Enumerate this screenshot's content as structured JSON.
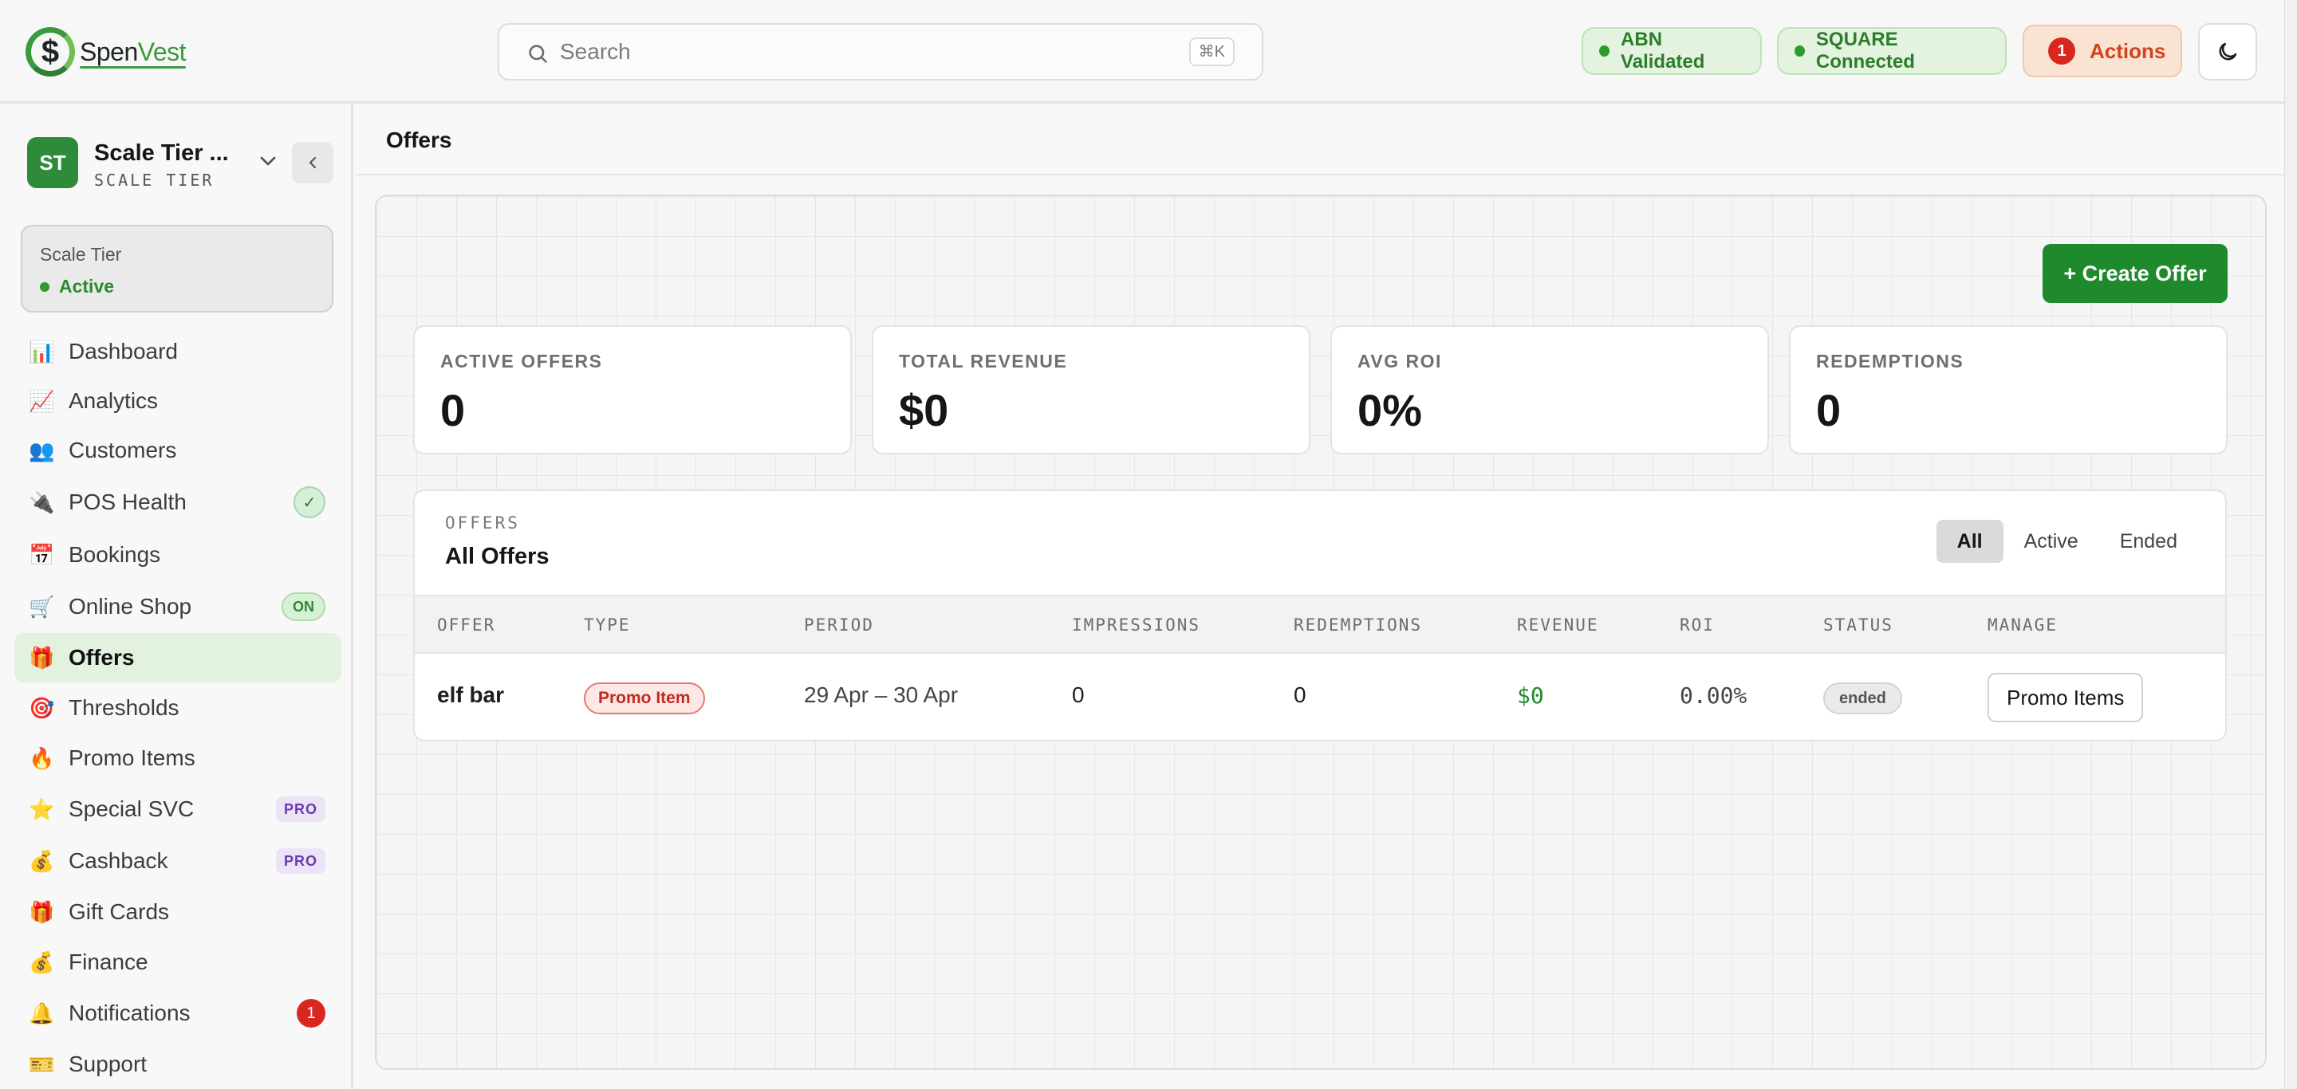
{
  "brand": {
    "name_part1": "Spen",
    "name_part2": "Vest",
    "logo_symbol": "$"
  },
  "search": {
    "placeholder": "Search",
    "shortcut": "⌘K"
  },
  "header_status": {
    "abn": "ABN Validated",
    "square": "SQUARE Connected",
    "actions_label": "Actions",
    "actions_count": "1"
  },
  "org": {
    "initials": "ST",
    "name": "Scale Tier ...",
    "tier": "SCALE TIER"
  },
  "tier_card": {
    "title": "Scale Tier",
    "status": "Active"
  },
  "sidebar": {
    "items": [
      {
        "label": "Dashboard",
        "icon": "📊"
      },
      {
        "label": "Analytics",
        "icon": "📈"
      },
      {
        "label": "Customers",
        "icon": "👥"
      },
      {
        "label": "POS Health",
        "icon": "🔌",
        "badge": "✓"
      },
      {
        "label": "Bookings",
        "icon": "📅"
      },
      {
        "label": "Online Shop",
        "icon": "🛒",
        "badge": "ON"
      },
      {
        "label": "Offers",
        "icon": "🎁"
      },
      {
        "label": "Thresholds",
        "icon": "🎯"
      },
      {
        "label": "Promo Items",
        "icon": "🔥"
      },
      {
        "label": "Special SVC",
        "icon": "⭐",
        "badge": "PRO"
      },
      {
        "label": "Cashback",
        "icon": "💰",
        "badge": "PRO"
      },
      {
        "label": "Gift Cards",
        "icon": "🎁"
      },
      {
        "label": "Finance",
        "icon": "💰"
      },
      {
        "label": "Notifications",
        "icon": "🔔",
        "badge": "1"
      },
      {
        "label": "Support",
        "icon": "🎫"
      }
    ],
    "active": "Offers"
  },
  "page": {
    "title": "Offers",
    "create_label": "+ Create Offer"
  },
  "stats": [
    {
      "label": "ACTIVE OFFERS",
      "value": "0"
    },
    {
      "label": "TOTAL REVENUE",
      "value": "$0"
    },
    {
      "label": "AVG ROI",
      "value": "0%"
    },
    {
      "label": "REDEMPTIONS",
      "value": "0"
    }
  ],
  "offers_table": {
    "kicker": "OFFERS",
    "title": "All Offers",
    "filters": [
      "All",
      "Active",
      "Ended"
    ],
    "selected_filter": "All",
    "columns": [
      "OFFER",
      "TYPE",
      "PERIOD",
      "IMPRESSIONS",
      "REDEMPTIONS",
      "REVENUE",
      "ROI",
      "STATUS",
      "MANAGE"
    ],
    "rows": [
      {
        "offer": "elf bar",
        "type": "Promo Item",
        "period": "29 Apr – 30 Apr",
        "impressions": "0",
        "redemptions": "0",
        "revenue": "$0",
        "roi": "0.00%",
        "status": "ended",
        "manage": "Promo Items"
      }
    ]
  },
  "colors": {
    "accent": "#1f8a2c",
    "danger": "#d9261f",
    "pro": "#6b3bb0"
  }
}
